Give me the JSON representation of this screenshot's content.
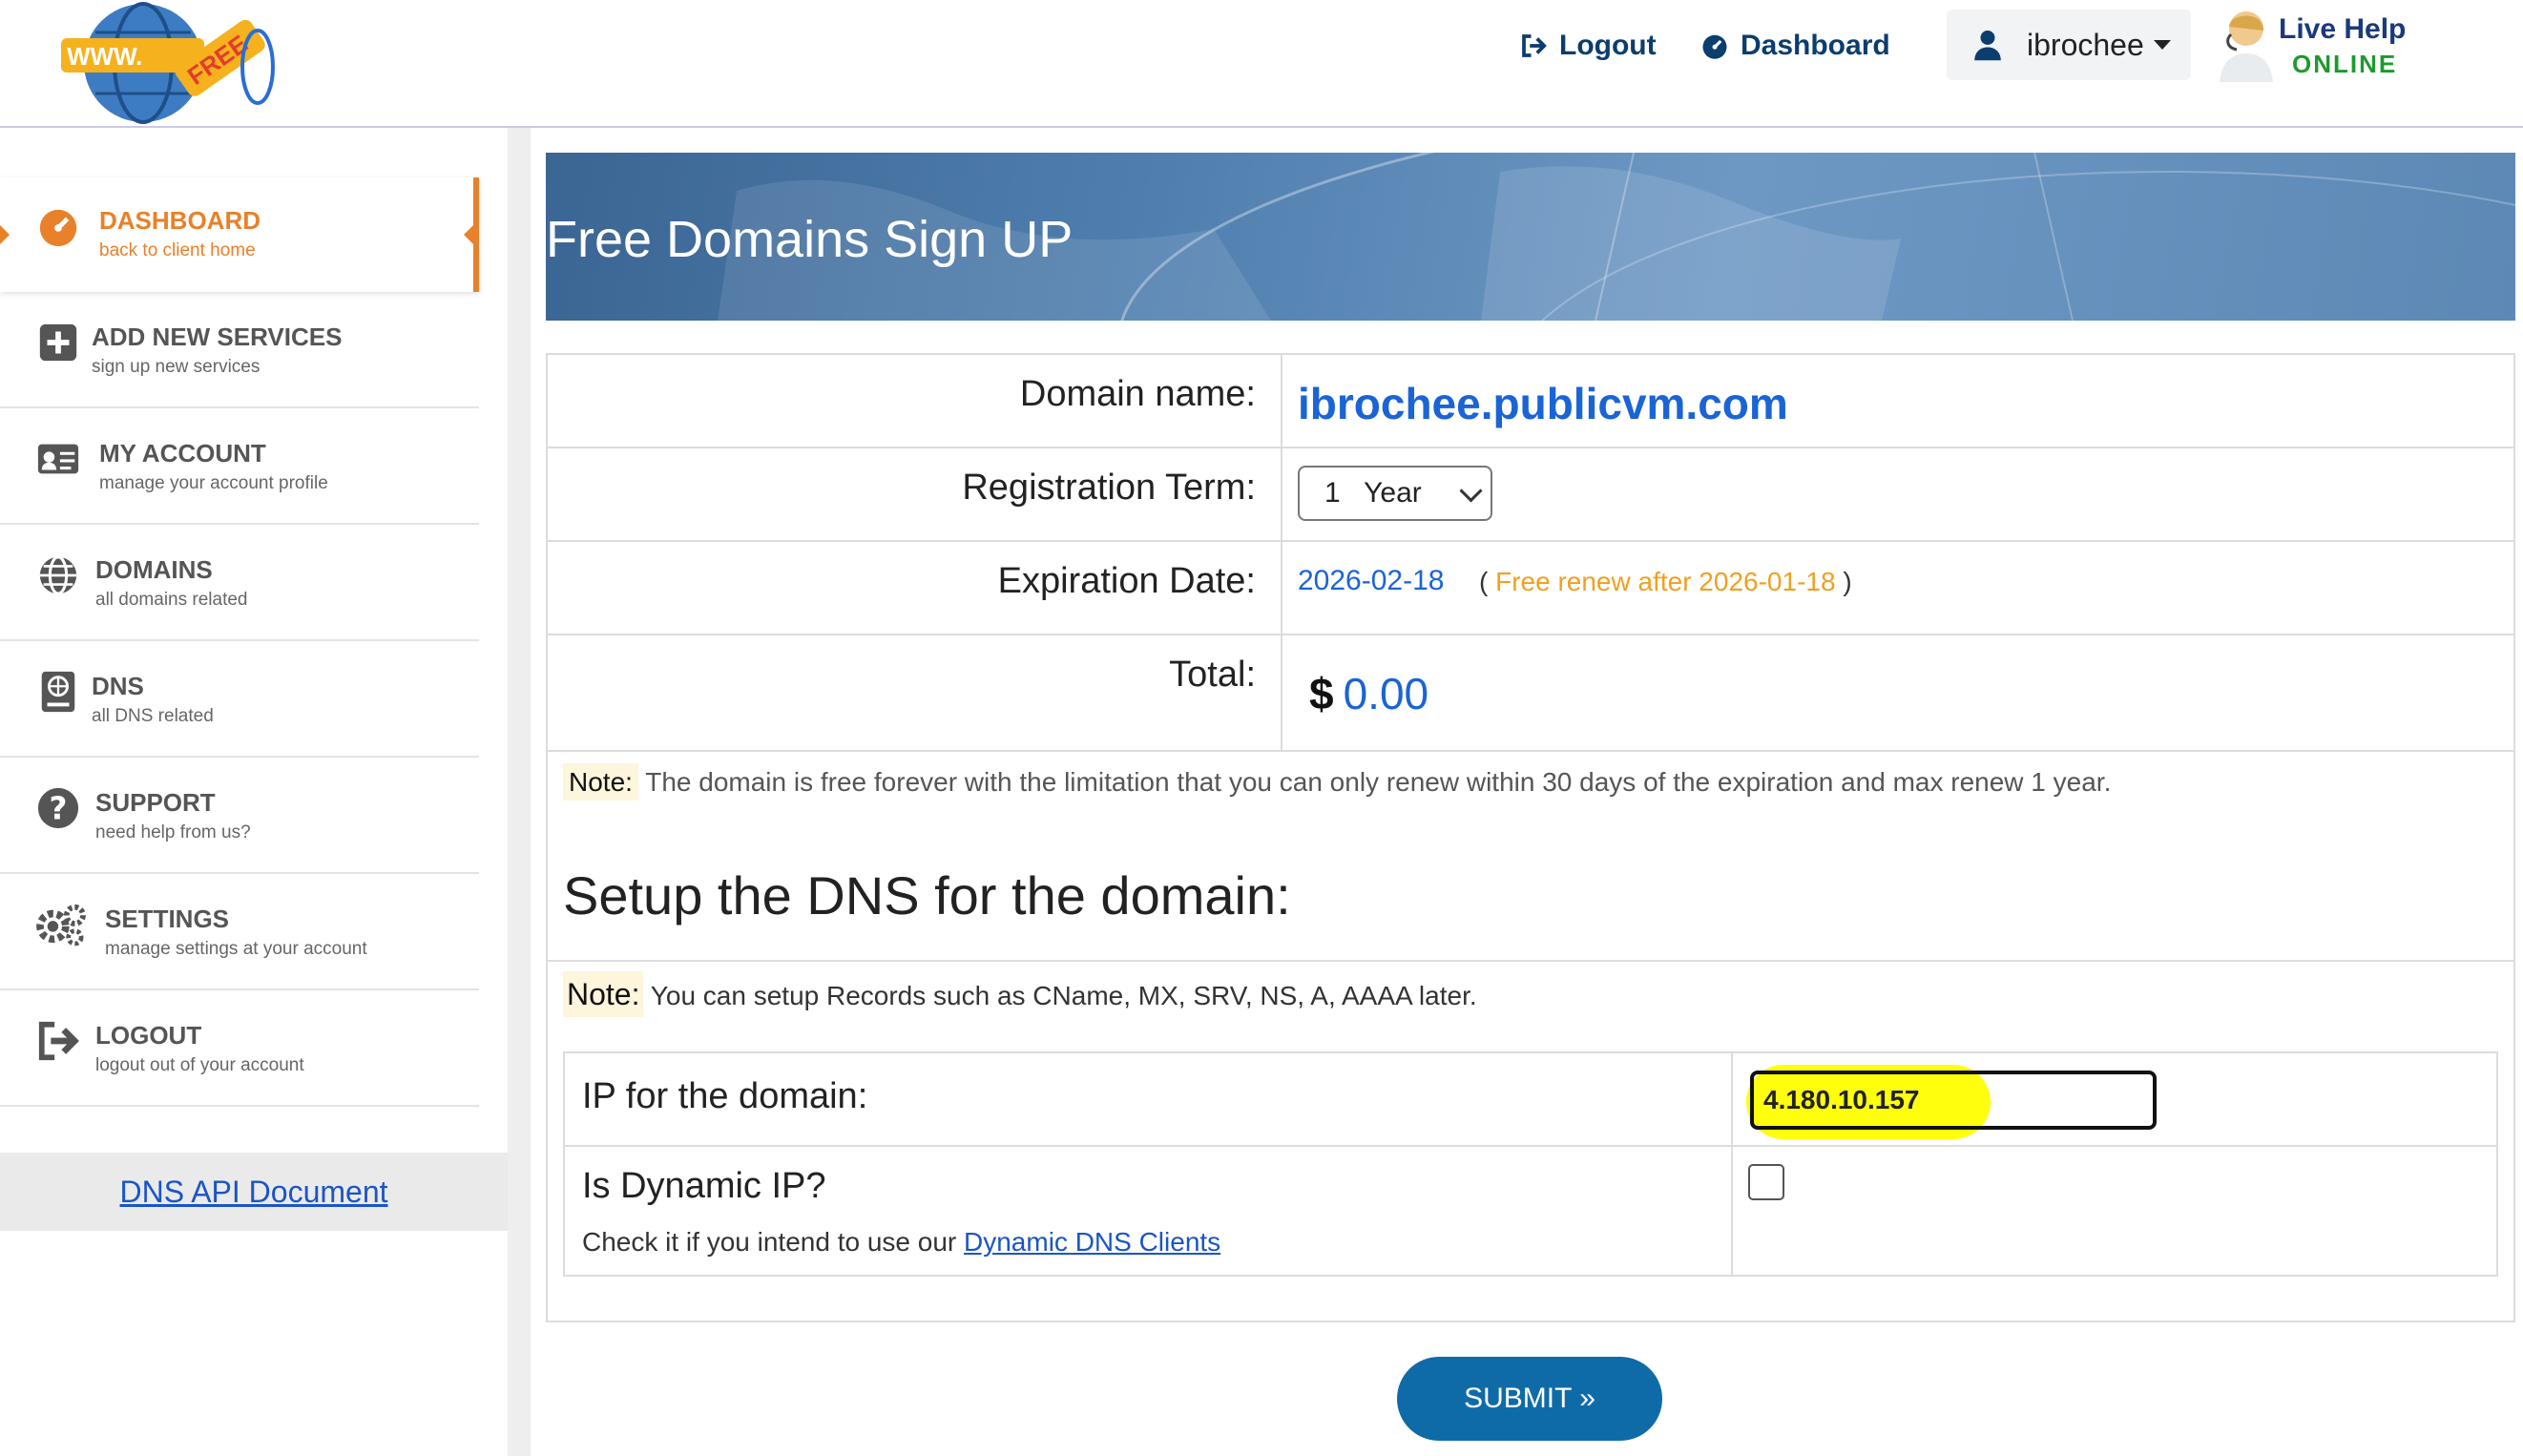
{
  "header": {
    "logo_text": "WWW. FREE",
    "logout_label": "Logout",
    "dashboard_label": "Dashboard",
    "username": "ibrochee",
    "live_help_title": "Live Help",
    "live_help_status": "ONLINE"
  },
  "sidebar": {
    "items": [
      {
        "title": "DASHBOARD",
        "subtitle": "back to client home",
        "icon": "dashboard-gauge-icon",
        "active": true
      },
      {
        "title": "ADD NEW SERVICES",
        "subtitle": "sign up new services",
        "icon": "plus-square-icon"
      },
      {
        "title": "MY ACCOUNT",
        "subtitle": "manage your account profile",
        "icon": "id-card-icon"
      },
      {
        "title": "DOMAINS",
        "subtitle": "all domains related",
        "icon": "globe-icon"
      },
      {
        "title": "DNS",
        "subtitle": "all DNS related",
        "icon": "dns-book-icon"
      },
      {
        "title": "SUPPORT",
        "subtitle": "need help from us?",
        "icon": "question-circle-icon"
      },
      {
        "title": "SETTINGS",
        "subtitle": "manage settings at your account",
        "icon": "gears-icon"
      },
      {
        "title": "LOGOUT",
        "subtitle": "logout out of your account",
        "icon": "sign-out-icon"
      }
    ],
    "api_link": "DNS API Document"
  },
  "banner": {
    "title": "Free Domains Sign UP"
  },
  "form": {
    "domain_label": "Domain name:",
    "domain_value": "ibrochee.publicvm.com",
    "term_label": "Registration Term:",
    "term_value": "1   Year",
    "expiration_label": "Expiration Date:",
    "expiration_value": "2026-02-18",
    "renew_open": "(",
    "renew_note": "Free renew after 2026-01-18",
    "renew_close": ")",
    "total_label": "Total:",
    "currency": "$",
    "total_value": "0.00",
    "note_tag": "Note:",
    "note_text": "The domain is free forever with the limitation that you can only renew within 30 days of the expiration and max renew 1 year."
  },
  "dns": {
    "heading": "Setup the DNS for the domain:",
    "note_tag": "Note:",
    "note_text": "You can setup Records such as CName, MX, SRV, NS, A, AAAA later.",
    "ip_label": "IP for the domain:",
    "ip_value": "4.180.10.157",
    "dynamic_label": "Is Dynamic IP?",
    "dynamic_help": "Check it if you intend to use our",
    "dynamic_link": "Dynamic DNS Clients",
    "dynamic_checked": false
  },
  "submit_label": "SUBMIT »",
  "colors": {
    "accent_orange": "#e8812a",
    "link_blue": "#1a64d6",
    "button_blue": "#0f6ba8",
    "highlight_yellow": "#ffff00"
  }
}
